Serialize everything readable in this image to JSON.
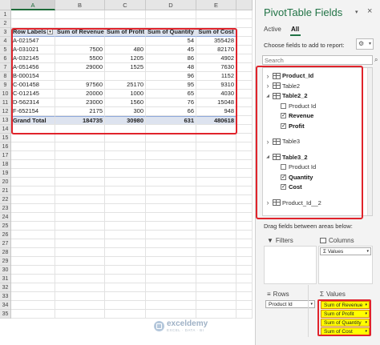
{
  "sheet": {
    "columns": [
      {
        "letter": "A",
        "width": 55,
        "selected": true
      },
      {
        "letter": "B",
        "width": 62,
        "selected": false
      },
      {
        "letter": "C",
        "width": 51,
        "selected": false
      },
      {
        "letter": "D",
        "width": 63,
        "selected": false
      },
      {
        "letter": "E",
        "width": 50,
        "selected": false
      }
    ],
    "rows": [
      {
        "n": "1",
        "cells": [
          "",
          "",
          "",
          "",
          ""
        ]
      },
      {
        "n": "2",
        "cells": [
          "",
          "",
          "",
          "",
          ""
        ]
      },
      {
        "n": "3",
        "type": "hdr",
        "cells": [
          "Row Labels",
          "Sum of Revenue",
          "Sum of Profit",
          "Sum of Quantity",
          "Sum of Cost"
        ]
      },
      {
        "n": "4",
        "cells": [
          "A-021547",
          "",
          "",
          "54",
          "355428"
        ]
      },
      {
        "n": "5",
        "cells": [
          "A-031021",
          "7500",
          "480",
          "45",
          "82170"
        ]
      },
      {
        "n": "6",
        "cells": [
          "A-032145",
          "5500",
          "1205",
          "86",
          "4902"
        ]
      },
      {
        "n": "7",
        "cells": [
          "A-051456",
          "29000",
          "1525",
          "48",
          "7630"
        ]
      },
      {
        "n": "8",
        "cells": [
          "B-000154",
          "",
          "",
          "96",
          "1152"
        ]
      },
      {
        "n": "9",
        "cells": [
          "C-001458",
          "97560",
          "25170",
          "95",
          "9310"
        ]
      },
      {
        "n": "10",
        "cells": [
          "C-012145",
          "20000",
          "1000",
          "65",
          "4030"
        ]
      },
      {
        "n": "11",
        "cells": [
          "D-562314",
          "23000",
          "1560",
          "76",
          "15048"
        ]
      },
      {
        "n": "12",
        "cells": [
          "F-652154",
          "2175",
          "300",
          "66",
          "948"
        ]
      },
      {
        "n": "13",
        "type": "total",
        "cells": [
          "Grand Total",
          "184735",
          "30980",
          "631",
          "480618"
        ]
      },
      {
        "n": "14",
        "cells": [
          "",
          "",
          "",
          "",
          ""
        ]
      },
      {
        "n": "15",
        "cells": [
          "",
          "",
          "",
          "",
          ""
        ]
      },
      {
        "n": "16",
        "cells": [
          "",
          "",
          "",
          "",
          ""
        ]
      },
      {
        "n": "17",
        "cells": [
          "",
          "",
          "",
          "",
          ""
        ]
      },
      {
        "n": "18",
        "cells": [
          "",
          "",
          "",
          "",
          ""
        ]
      },
      {
        "n": "19",
        "cells": [
          "",
          "",
          "",
          "",
          ""
        ]
      },
      {
        "n": "20",
        "cells": [
          "",
          "",
          "",
          "",
          ""
        ]
      },
      {
        "n": "21",
        "cells": [
          "",
          "",
          "",
          "",
          ""
        ]
      },
      {
        "n": "22",
        "cells": [
          "",
          "",
          "",
          "",
          ""
        ]
      },
      {
        "n": "23",
        "cells": [
          "",
          "",
          "",
          "",
          ""
        ]
      },
      {
        "n": "24",
        "cells": [
          "",
          "",
          "",
          "",
          ""
        ]
      },
      {
        "n": "25",
        "cells": [
          "",
          "",
          "",
          "",
          ""
        ]
      },
      {
        "n": "26",
        "cells": [
          "",
          "",
          "",
          "",
          ""
        ]
      },
      {
        "n": "27",
        "cells": [
          "",
          "",
          "",
          "",
          ""
        ]
      },
      {
        "n": "28",
        "cells": [
          "",
          "",
          "",
          "",
          ""
        ]
      },
      {
        "n": "29",
        "cells": [
          "",
          "",
          "",
          "",
          ""
        ]
      },
      {
        "n": "30",
        "cells": [
          "",
          "",
          "",
          "",
          ""
        ]
      },
      {
        "n": "31",
        "cells": [
          "",
          "",
          "",
          "",
          ""
        ]
      },
      {
        "n": "32",
        "cells": [
          "",
          "",
          "",
          "",
          ""
        ]
      },
      {
        "n": "33",
        "cells": [
          "",
          "",
          "",
          "",
          ""
        ]
      },
      {
        "n": "34",
        "cells": [
          "",
          "",
          "",
          "",
          ""
        ]
      },
      {
        "n": "35",
        "cells": [
          "",
          "",
          "",
          "",
          ""
        ]
      }
    ],
    "watermark": {
      "name": "exceldemy",
      "tagline": "EXCEL · DATA · BI"
    }
  },
  "pane": {
    "title": "PivotTable Fields",
    "tabs": {
      "active": "Active",
      "all": "All"
    },
    "choose_label": "Choose fields to add to report:",
    "gear_icon": "gear-icon",
    "search_placeholder": "Search",
    "fields": [
      {
        "kind": "table",
        "expanded": false,
        "name": "Product_Id",
        "bold": true
      },
      {
        "kind": "table",
        "expanded": false,
        "name": "Table2",
        "bold": false
      },
      {
        "kind": "table",
        "expanded": true,
        "name": "Table2_2",
        "bold": true
      },
      {
        "kind": "field",
        "name": "Product Id",
        "checked": false
      },
      {
        "kind": "field",
        "name": "Revenue",
        "checked": true
      },
      {
        "kind": "field",
        "name": "Profit",
        "checked": true
      },
      {
        "kind": "spacer"
      },
      {
        "kind": "table",
        "expanded": false,
        "name": "Table3",
        "bold": false
      },
      {
        "kind": "spacer"
      },
      {
        "kind": "table",
        "expanded": true,
        "name": "Table3_2",
        "bold": true
      },
      {
        "kind": "field",
        "name": "Product Id",
        "checked": false
      },
      {
        "kind": "field",
        "name": "Quantity",
        "checked": true
      },
      {
        "kind": "field",
        "name": "Cost",
        "checked": true
      },
      {
        "kind": "spacer"
      },
      {
        "kind": "table",
        "expanded": false,
        "name": "Product_Id__2",
        "bold": false
      }
    ],
    "drag_label": "Drag fields between areas below:",
    "areas": {
      "filters": "Filters",
      "columns": "Columns",
      "rows": "Rows",
      "values": "Values",
      "columns_items": [
        "Σ Values"
      ],
      "rows_items": [
        "Product Id"
      ],
      "values_items": [
        "Sum of Revenue",
        "Sum of Profit",
        "Sum of Quantity",
        "Sum of Cost"
      ]
    },
    "highlight_color": "#ffff00",
    "outline_color": "#e0232b",
    "accent_color": "#217346"
  }
}
